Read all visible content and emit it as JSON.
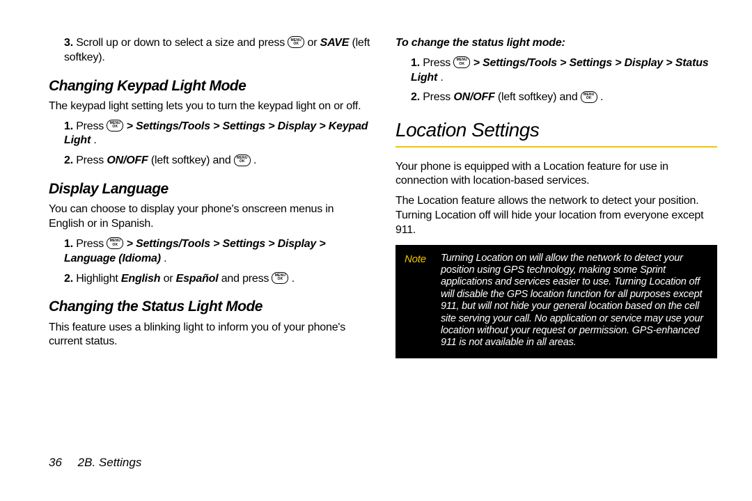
{
  "left": {
    "step3_a": "Scroll up or down to select a size and press ",
    "step3_b": " or ",
    "step3_c": "SAVE",
    "step3_d": " (left softkey).",
    "h_keypad": "Changing Keypad Light Mode",
    "keypad_intro": "The keypad light setting lets you to turn the keypad light on or off.",
    "k1_a": "Press ",
    "k1_b": " > Settings/Tools > Settings > Display > Keypad Light",
    "k1_c": ".",
    "k2_a": "Press ",
    "k2_b": "ON/OFF",
    "k2_c": " (left softkey) and ",
    "k2_d": " .",
    "h_lang": "Display Language",
    "lang_intro": "You can choose to display your phone's onscreen menus in English or in Spanish.",
    "l1_a": "Press ",
    "l1_b": " > Settings/Tools > Settings > Display > Language (Idioma)",
    "l1_c": ".",
    "l2_a": "Highlight ",
    "l2_b": "English",
    "l2_c": " or ",
    "l2_d": "Español",
    "l2_e": " and press ",
    "l2_f": " .",
    "h_status": "Changing the Status Light Mode",
    "status_intro": "This feature uses a blinking light to inform you of your phone's current status."
  },
  "right": {
    "lead": "To change the status light mode:",
    "s1_a": "Press ",
    "s1_b": " > Settings/Tools > Settings > Display > Status Light",
    "s1_c": ".",
    "s2_a": "Press ",
    "s2_b": "ON/OFF",
    "s2_c": " (left softkey) and ",
    "s2_d": " .",
    "h_loc": "Location Settings",
    "loc_p1": "Your phone is equipped with a Location feature for use in connection with location-based services.",
    "loc_p2": "The Location feature allows the network to detect your position. Turning Location off will hide your location from everyone except 911.",
    "note_label": "Note",
    "note_text": "Turning Location on will allow the network to detect your position using GPS technology, making some Sprint applications and services easier to use. Turning Location off will disable the GPS location function for all purposes except 911, but will not hide your general location based on the cell site serving your call. No application or service may use your location without your request or permission. GPS-enhanced 911 is not available in all areas."
  },
  "footer": {
    "page": "36",
    "section": "2B. Settings"
  },
  "icon": {
    "top": "MENU",
    "bot": "OK"
  }
}
